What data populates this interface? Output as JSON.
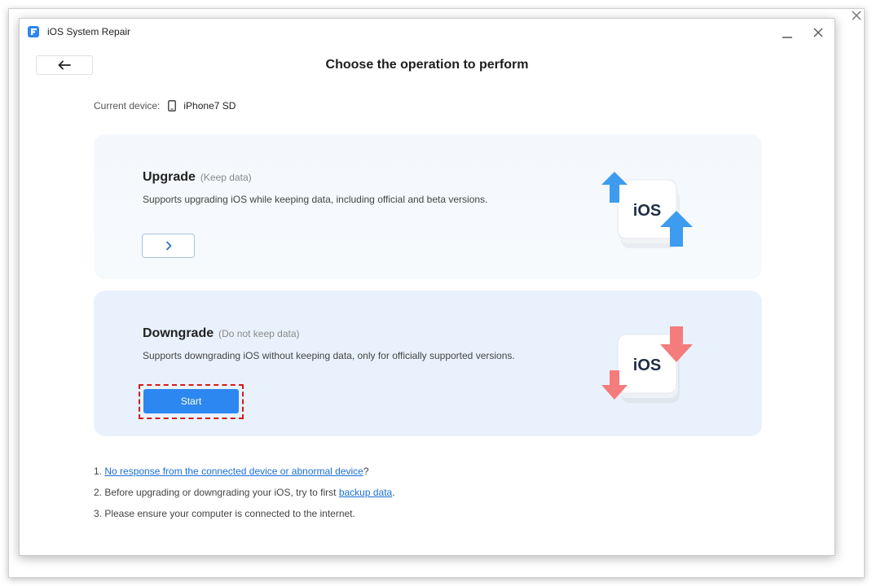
{
  "app": {
    "title": "iOS System Repair"
  },
  "header": {
    "title": "Choose the operation to perform"
  },
  "device": {
    "label": "Current device:",
    "name": "iPhone7 SD"
  },
  "upgrade": {
    "title": "Upgrade",
    "subtitle": "(Keep data)",
    "description": "Supports upgrading iOS while keeping data, including official and beta versions.",
    "badge": "iOS"
  },
  "downgrade": {
    "title": "Downgrade",
    "subtitle": "(Do not keep data)",
    "description": "Supports downgrading iOS without keeping data, only for officially supported versions.",
    "button_label": "Start",
    "badge": "iOS"
  },
  "notes": {
    "n1_prefix": "1. ",
    "n1_link": "No response from the connected device or abnormal device",
    "n1_suffix": "?",
    "n2_prefix": "2. Before upgrading or downgrading your iOS, try to first ",
    "n2_link": "backup data",
    "n2_suffix": ".",
    "n3": "3. Please ensure your computer is connected to the internet."
  },
  "colors": {
    "accent": "#2d87f0",
    "link": "#1a6fd6",
    "highlight": "#d61a1a",
    "up_arrow": "#3d9cf0",
    "down_arrow": "#f57c7c"
  }
}
